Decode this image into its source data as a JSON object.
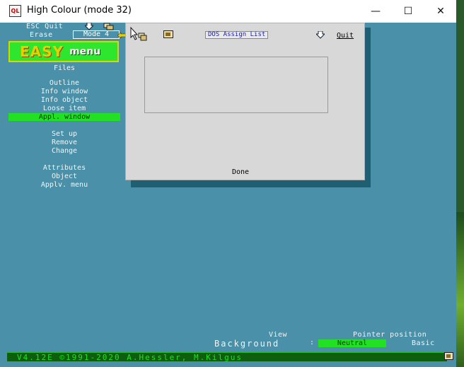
{
  "window": {
    "title": "High Colour (mode 32)",
    "minimize": "—",
    "maximize": "☐",
    "close": "✕"
  },
  "topbar": {
    "esc_quit": "ESC Quit",
    "erase": "Erase",
    "mode": "Mode 4"
  },
  "logo": {
    "easy": "EASY",
    "menu": "menu"
  },
  "menu": {
    "files": "Files",
    "outline": "Outline",
    "info_window": "Info window",
    "info_object": "Info object",
    "loose_item": "Loose item",
    "appl_window": "Appl. window",
    "set_up": "Set up",
    "remove": "Remove",
    "change": "Change",
    "attributes": "Attributes",
    "object": "Object",
    "applv_menu": "Applv. menu"
  },
  "dialog": {
    "title": "DOS Assign List",
    "quit": "Quit",
    "done": "Done",
    "list_items": []
  },
  "bottom": {
    "view": "View",
    "pointer_position": "Pointer position",
    "background": "Background",
    "colon": ":",
    "neutral": "Neutral",
    "basic": "Basic",
    "status": "V4.12E ©1991-2020 A.Hessler, M.Kilgus"
  },
  "colors": {
    "screen_bg": "#4a90a8",
    "highlight": "#22e022",
    "status_bar": "#0d5f0d"
  }
}
